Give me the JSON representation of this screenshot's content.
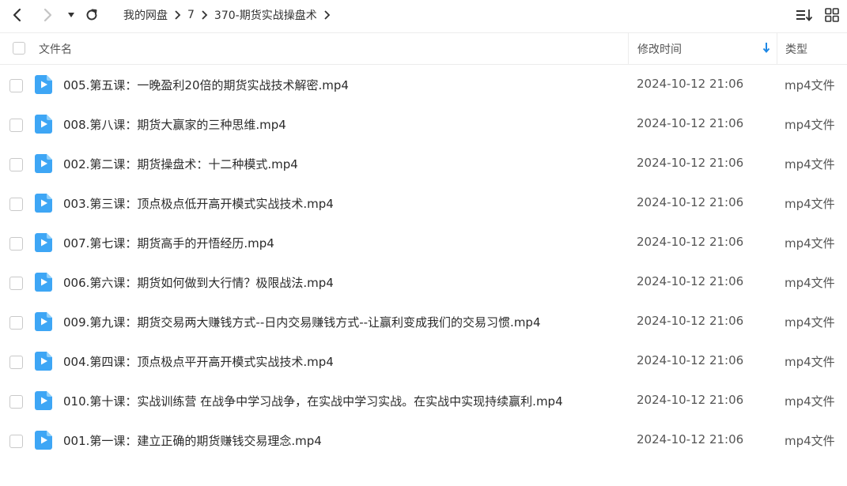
{
  "breadcrumb": [
    "我的网盘",
    "7",
    "370-期货实战操盘术"
  ],
  "header": {
    "name": "文件名",
    "modified": "修改时间",
    "type": "类型"
  },
  "files": [
    {
      "name": "005.第五课：一晚盈利20倍的期货实战技术解密.mp4",
      "modified": "2024-10-12 21:06",
      "type": "mp4文件"
    },
    {
      "name": "008.第八课：期货大赢家的三种思维.mp4",
      "modified": "2024-10-12 21:06",
      "type": "mp4文件"
    },
    {
      "name": "002.第二课：期货操盘术：十二种模式.mp4",
      "modified": "2024-10-12 21:06",
      "type": "mp4文件"
    },
    {
      "name": "003.第三课：顶点极点低开高开模式实战技术.mp4",
      "modified": "2024-10-12 21:06",
      "type": "mp4文件"
    },
    {
      "name": "007.第七课：期货高手的开悟经历.mp4",
      "modified": "2024-10-12 21:06",
      "type": "mp4文件"
    },
    {
      "name": "006.第六课：期货如何做到大行情？极限战法.mp4",
      "modified": "2024-10-12 21:06",
      "type": "mp4文件"
    },
    {
      "name": "009.第九课：期货交易两大赚钱方式--日内交易赚钱方式--让赢利变成我们的交易习惯.mp4",
      "modified": "2024-10-12 21:06",
      "type": "mp4文件"
    },
    {
      "name": "004.第四课：顶点极点平开高开模式实战技术.mp4",
      "modified": "2024-10-12 21:06",
      "type": "mp4文件"
    },
    {
      "name": "010.第十课：实战训练营 在战争中学习战争，在实战中学习实战。在实战中实现持续赢利.mp4",
      "modified": "2024-10-12 21:06",
      "type": "mp4文件"
    },
    {
      "name": "001.第一课：建立正确的期货赚钱交易理念.mp4",
      "modified": "2024-10-12 21:06",
      "type": "mp4文件"
    }
  ],
  "icons": {
    "back": "chevron-left-icon",
    "forward": "chevron-right-icon",
    "history": "caret-down-icon",
    "refresh": "refresh-icon",
    "sort": "sort-desc-icon",
    "list_view": "list-sort-icon",
    "grid_view": "grid-icon",
    "file": "video-file-icon"
  },
  "colors": {
    "accent": "#1e88e5",
    "file_icon": "#3ea6f5"
  }
}
